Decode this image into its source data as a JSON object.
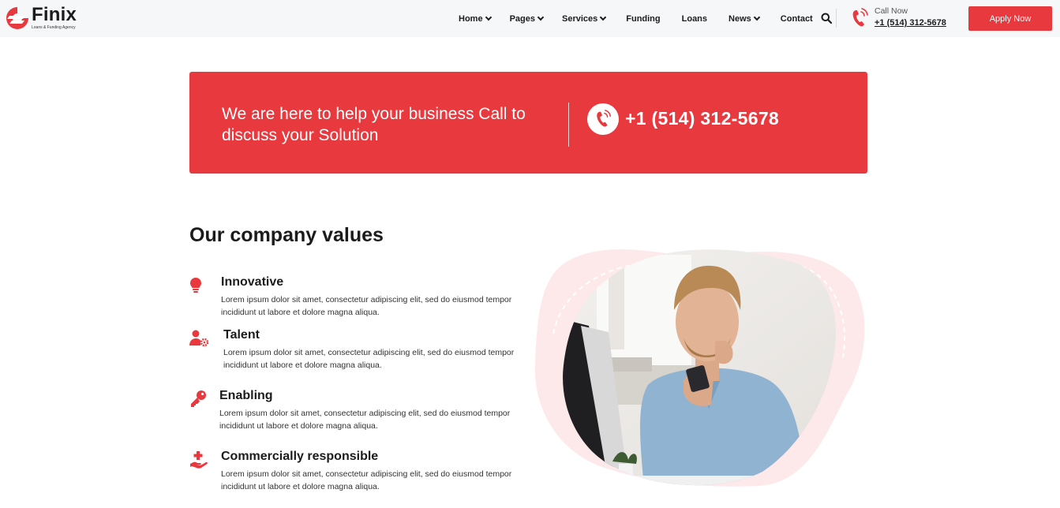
{
  "header": {
    "logo_name": "Finix",
    "logo_tagline": "Loans & Funding Agency",
    "nav": [
      {
        "label": "Home",
        "dropdown": true
      },
      {
        "label": "Pages",
        "dropdown": true
      },
      {
        "label": "Services",
        "dropdown": true
      },
      {
        "label": "Funding",
        "dropdown": false
      },
      {
        "label": "Loans",
        "dropdown": false
      },
      {
        "label": "News",
        "dropdown": true
      },
      {
        "label": "Contact",
        "dropdown": false
      }
    ],
    "call_label": "Call Now",
    "call_number": "+1 (514) 312-5678",
    "apply_label": "Apply Now"
  },
  "cta": {
    "text": "We are here to help your business Call to discuss your Solution",
    "phone": "+1 (514) 312-5678"
  },
  "values": {
    "title": "Our company values",
    "items": [
      {
        "title": "Innovative",
        "icon": "lightbulb-icon",
        "desc": "Lorem ipsum dolor sit amet, consectetur adipiscing elit, sed do eiusmod tempor incididunt ut labore et dolore magna aliqua."
      },
      {
        "title": "Talent",
        "icon": "user-gear-icon",
        "desc": "Lorem ipsum dolor sit amet, consectetur adipiscing elit, sed do eiusmod tempor incididunt ut labore et dolore magna aliqua."
      },
      {
        "title": "Enabling",
        "icon": "key-icon",
        "desc": "Lorem ipsum dolor sit amet, consectetur adipiscing elit, sed do eiusmod tempor incididunt ut labore et dolore magna aliqua."
      },
      {
        "title": "Commercially responsible",
        "icon": "hand-plus-icon",
        "desc": "Lorem ipsum dolor sit amet, consectetur adipiscing elit, sed do eiusmod tempor incididunt ut labore et dolore magna aliqua."
      }
    ]
  },
  "colors": {
    "accent": "#e8393f",
    "header_bg": "#f6f7f9",
    "blob_pink": "#fde9ea"
  }
}
